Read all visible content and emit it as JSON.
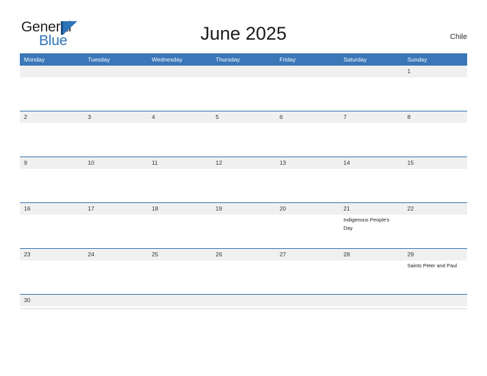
{
  "brand": {
    "name_part1": "General",
    "name_part2": "Blue",
    "mark": "triangle-logo-mark",
    "color_dark": "#231f20",
    "color_blue": "#2b74b8"
  },
  "header": {
    "title": "June 2025",
    "region": "Chile"
  },
  "calendar": {
    "month": "June",
    "year": "2025",
    "header_bg": "#3a76b8",
    "band_bg": "#f0f0f0",
    "rule_color": "#2f6fae",
    "weekdays": [
      "Monday",
      "Tuesday",
      "Wednesday",
      "Thursday",
      "Friday",
      "Saturday",
      "Sunday"
    ],
    "weeks": [
      {
        "days": [
          {
            "num": "",
            "events": []
          },
          {
            "num": "",
            "events": []
          },
          {
            "num": "",
            "events": []
          },
          {
            "num": "",
            "events": []
          },
          {
            "num": "",
            "events": []
          },
          {
            "num": "",
            "events": []
          },
          {
            "num": "1",
            "events": []
          }
        ]
      },
      {
        "days": [
          {
            "num": "2",
            "events": []
          },
          {
            "num": "3",
            "events": []
          },
          {
            "num": "4",
            "events": []
          },
          {
            "num": "5",
            "events": []
          },
          {
            "num": "6",
            "events": []
          },
          {
            "num": "7",
            "events": []
          },
          {
            "num": "8",
            "events": []
          }
        ]
      },
      {
        "days": [
          {
            "num": "9",
            "events": []
          },
          {
            "num": "10",
            "events": []
          },
          {
            "num": "11",
            "events": []
          },
          {
            "num": "12",
            "events": []
          },
          {
            "num": "13",
            "events": []
          },
          {
            "num": "14",
            "events": []
          },
          {
            "num": "15",
            "events": []
          }
        ]
      },
      {
        "days": [
          {
            "num": "16",
            "events": []
          },
          {
            "num": "17",
            "events": []
          },
          {
            "num": "18",
            "events": []
          },
          {
            "num": "19",
            "events": []
          },
          {
            "num": "20",
            "events": []
          },
          {
            "num": "21",
            "events": [
              "Indigenous People's Day"
            ]
          },
          {
            "num": "22",
            "events": []
          }
        ]
      },
      {
        "days": [
          {
            "num": "23",
            "events": []
          },
          {
            "num": "24",
            "events": []
          },
          {
            "num": "25",
            "events": []
          },
          {
            "num": "26",
            "events": []
          },
          {
            "num": "27",
            "events": []
          },
          {
            "num": "28",
            "events": []
          },
          {
            "num": "29",
            "events": [
              "Saints Peter and Paul"
            ]
          }
        ]
      },
      {
        "days": [
          {
            "num": "30",
            "events": []
          },
          {
            "num": "",
            "events": []
          },
          {
            "num": "",
            "events": []
          },
          {
            "num": "",
            "events": []
          },
          {
            "num": "",
            "events": []
          },
          {
            "num": "",
            "events": []
          },
          {
            "num": "",
            "events": []
          }
        ]
      }
    ]
  }
}
